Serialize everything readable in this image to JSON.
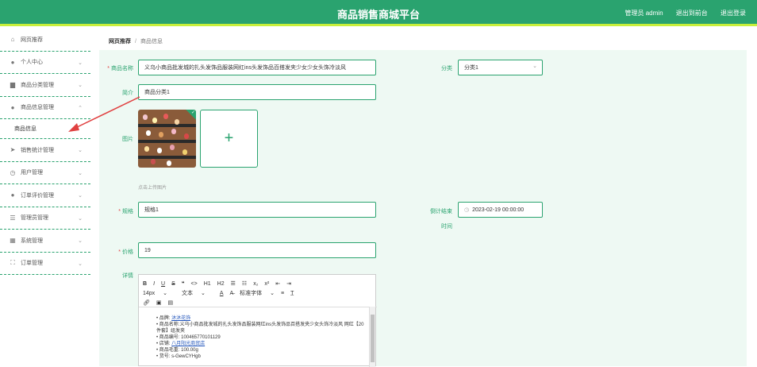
{
  "header": {
    "title": "商品销售商城平台",
    "admin": "管理员 admin",
    "back_to_front": "退出到前台",
    "logout": "退出登录"
  },
  "sidebar": {
    "items": [
      {
        "label": "网页推荐",
        "icon": "home-icon"
      },
      {
        "label": "个人中心",
        "icon": "user-icon"
      },
      {
        "label": "商品分类管理",
        "icon": "chat-icon"
      },
      {
        "label": "商品信息管理",
        "icon": "user-icon"
      },
      {
        "label": "商品信息",
        "icon": ""
      },
      {
        "label": "销售统计管理",
        "icon": "send-icon"
      },
      {
        "label": "用户管理",
        "icon": "clock-icon"
      },
      {
        "label": "订单评价管理",
        "icon": "user-icon"
      },
      {
        "label": "管理员管理",
        "icon": "list-icon"
      },
      {
        "label": "系统管理",
        "icon": "table-icon"
      },
      {
        "label": "订单管理",
        "icon": "expand-icon"
      }
    ]
  },
  "breadcrumb": {
    "home": "网页推荐",
    "sep": "/",
    "current": "商品信息"
  },
  "form": {
    "name_label": "商品名称",
    "name_value": "义乌小商品批发城的扎头发饰品服装网红ins头发饰品百搭发夹少女少女头饰冷淡风",
    "category_label": "分类",
    "category_value": "分类1",
    "intro_label": "简介",
    "intro_value": "商品分类1",
    "image_label": "图片",
    "upload_hint": "点击上传图片",
    "spec_label": "规格",
    "spec_value": "规格1",
    "countdown_label": "倒计结束",
    "countdown_label2": "时间",
    "countdown_value": "2023-02-19 00:00:00",
    "price_label": "价格",
    "price_value": "19",
    "detail_label": "详情"
  },
  "editor": {
    "toolbar1": [
      "B",
      "I",
      "U",
      "S",
      "❝",
      "<>",
      "H1",
      "H2",
      "☰",
      "☷",
      "x₂",
      "x²",
      "⇤",
      "⇥"
    ],
    "font_size": "14px",
    "text_label": "文本",
    "font_label": "标准字体",
    "lines": [
      {
        "label": "品牌:",
        "value": "沐沐花饰",
        "link": true
      },
      {
        "label": "商品名称:",
        "value": "义乌小商品批发城的扎头发饰品服装网红ins头发饰品百搭发夹少女头饰冷淡风 网红【20件套】组发夹",
        "link": false
      },
      {
        "label": "商品编号:",
        "value": "100465770101129",
        "link": false
      },
      {
        "label": "店铺:",
        "value": "八月阳光商贸店",
        "link": true
      },
      {
        "label": "商品毛重:",
        "value": "100.00g",
        "link": false
      },
      {
        "label": "货号:",
        "value": "s-GewCYHgb",
        "link": false
      }
    ]
  },
  "colors": {
    "primary": "#2aa36f",
    "accent_bar": "#c8ef3a",
    "bg": "#eef9f3",
    "arrow": "#e04040"
  }
}
